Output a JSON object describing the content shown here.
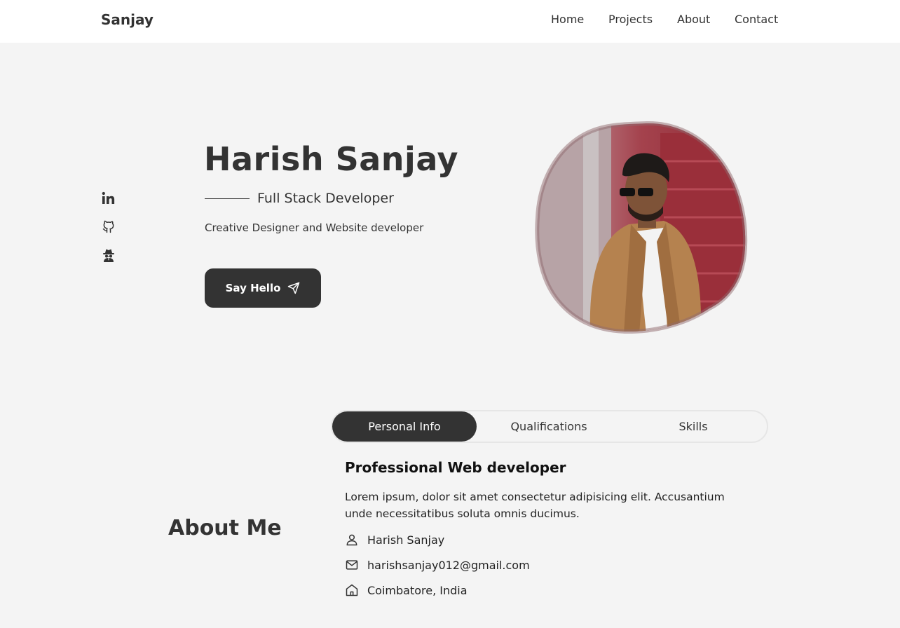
{
  "brand": "Sanjay",
  "nav": {
    "items": [
      {
        "label": "Home"
      },
      {
        "label": "Projects"
      },
      {
        "label": "About"
      },
      {
        "label": "Contact"
      }
    ]
  },
  "socials": [
    {
      "icon": "linkedin-icon"
    },
    {
      "icon": "github-icon"
    },
    {
      "icon": "incognito-icon"
    }
  ],
  "hero": {
    "title": "Harish Sanjay",
    "subtitle": "Full Stack Developer",
    "description": "Creative Designer and Website developer",
    "cta_label": "Say Hello",
    "cta_icon": "send-icon"
  },
  "about": {
    "section_title": "About Me",
    "tabs": [
      {
        "label": "Personal Info",
        "active": true
      },
      {
        "label": "Qualifications",
        "active": false
      },
      {
        "label": "Skills",
        "active": false
      }
    ],
    "heading": "Professional Web developer",
    "text": "Lorem ipsum, dolor sit amet consectetur adipisicing elit. Accusantium unde necessitatibus soluta omnis ducimus.",
    "info": [
      {
        "icon": "user-icon",
        "value": "Harish Sanjay"
      },
      {
        "icon": "mail-icon",
        "value": "harishsanjay012@gmail.com"
      },
      {
        "icon": "home-icon",
        "value": "Coimbatore, India"
      }
    ]
  },
  "colors": {
    "background": "#f4f4f4",
    "navbar": "#ffffff",
    "dark": "#333333",
    "tab_border": "#e6e6e6"
  }
}
